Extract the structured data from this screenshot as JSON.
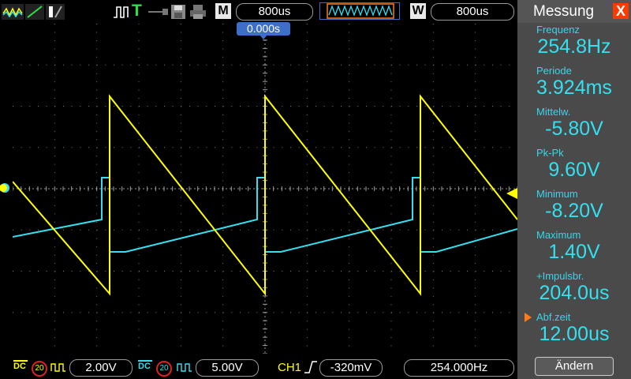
{
  "toolbar": {
    "m_label": "M",
    "m_time": "800us",
    "w_label": "W",
    "w_time": "800us",
    "t_label": "T"
  },
  "trigger_time": "0.000s",
  "panel": {
    "title": "Messung",
    "close": "X",
    "measurements": [
      {
        "label": "Frequenz",
        "value": "254.8Hz"
      },
      {
        "label": "Periode",
        "value": "3.924ms"
      },
      {
        "label": "Mittelw.",
        "value": "-5.80V"
      },
      {
        "label": "Pk-Pk",
        "value": "9.60V"
      },
      {
        "label": "Minimum",
        "value": "-8.20V"
      },
      {
        "label": "Maximum",
        "value": "1.40V"
      },
      {
        "label": "+Impulsbr.",
        "value": "204.0us"
      },
      {
        "label": "Abf.zeit",
        "value": "12.00us"
      }
    ],
    "button": "Ändern"
  },
  "bottom": {
    "ch1_bw": "20",
    "ch1_scale": "2.00V",
    "ch2_bw": "20",
    "ch2_scale": "5.00V",
    "trig_source": "CH1",
    "trig_level": "-320mV",
    "trig_freq": "254.000Hz"
  },
  "colors": {
    "ch1": "#ffff00",
    "ch2": "#34e0f0",
    "panel_bg": "#4a4a4a",
    "accent_orange": "#ff7a1a"
  }
}
